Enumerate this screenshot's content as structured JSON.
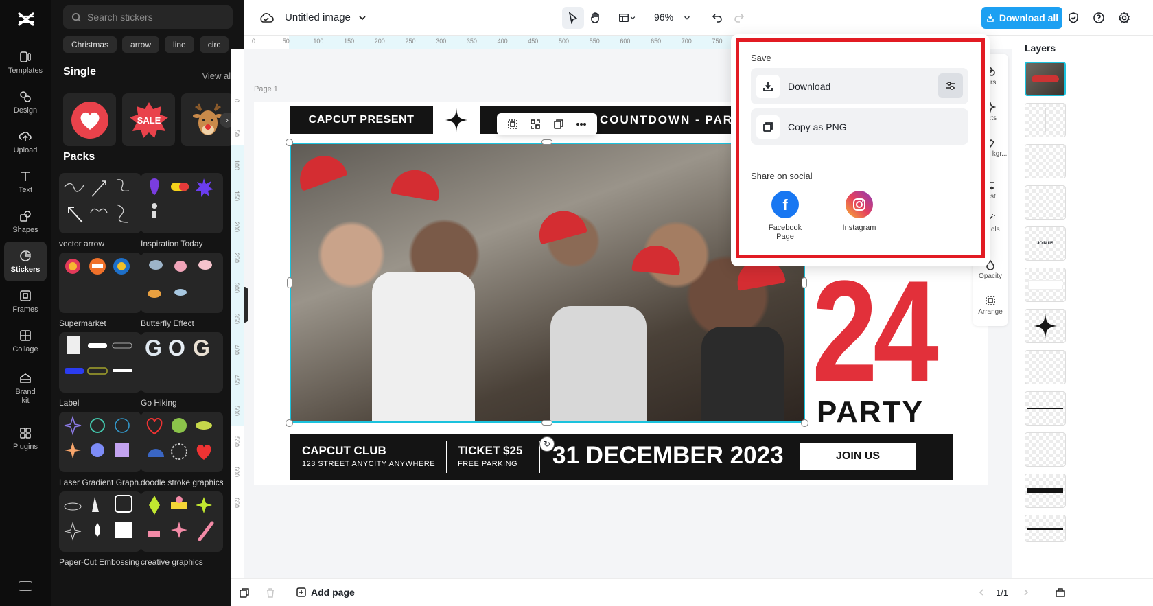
{
  "rail": {
    "items": [
      {
        "label": "Templates",
        "icon": "templates-icon"
      },
      {
        "label": "Design",
        "icon": "design-icon"
      },
      {
        "label": "Upload",
        "icon": "upload-icon"
      },
      {
        "label": "Text",
        "icon": "text-icon"
      },
      {
        "label": "Shapes",
        "icon": "shapes-icon"
      },
      {
        "label": "Stickers",
        "icon": "stickers-icon"
      },
      {
        "label": "Frames",
        "icon": "frames-icon"
      },
      {
        "label": "Collage",
        "icon": "collage-icon"
      },
      {
        "label": "Brand kit",
        "icon": "brand-kit-icon"
      },
      {
        "label": "Plugins",
        "icon": "plugins-icon"
      }
    ],
    "active": "Stickers"
  },
  "panel": {
    "search_placeholder": "Search stickers",
    "chips": [
      "Christmas",
      "arrow",
      "line",
      "circ"
    ],
    "single_title": "Single",
    "view_all": "View all",
    "single_stickers": [
      "heart",
      "SALE",
      "reindeer"
    ],
    "packs_title": "Packs",
    "packs": [
      {
        "label": "vector arrow"
      },
      {
        "label": "Inspiration Today"
      },
      {
        "label": "Supermarket"
      },
      {
        "label": "Butterfly Effect"
      },
      {
        "label": "Label"
      },
      {
        "label": "Go Hiking"
      },
      {
        "label": "Laser Gradient Graph..."
      },
      {
        "label": "doodle stroke graphics"
      },
      {
        "label": "Paper-Cut Embossing"
      },
      {
        "label": "creative graphics"
      }
    ]
  },
  "topbar": {
    "title": "Untitled image",
    "zoom": "96%",
    "download_all": "Download all"
  },
  "ruler": {
    "h_ticks": [
      "0",
      "50",
      "100",
      "150",
      "200",
      "250",
      "300",
      "350",
      "400",
      "450",
      "500",
      "550",
      "600",
      "650",
      "700",
      "750"
    ],
    "v_ticks": [
      "0",
      "50",
      "100",
      "150",
      "200",
      "250",
      "300",
      "350",
      "400",
      "450",
      "500",
      "550",
      "600",
      "650"
    ]
  },
  "canvas": {
    "page_label": "Page 1",
    "capcut_present": "CAPCUT PRESENT",
    "countdown": "COUNTDOWN - PART",
    "big_number": "24",
    "party": "PARTY",
    "club": "CAPCUT CLUB",
    "address": "123 STREET ANYCITY ANYWHERE",
    "ticket": "TICKET $25",
    "parking": "FREE PARKING",
    "date": "31 DECEMBER 2023",
    "join": "JOIN US"
  },
  "popover": {
    "save_label": "Save",
    "download_label": "Download",
    "copy_label": "Copy as PNG",
    "share_label": "Share on social",
    "facebook_label": "Facebook Page",
    "instagram_label": "Instagram"
  },
  "right_tools": [
    "ters",
    "ects",
    "move kgr...",
    "just",
    "art ols",
    "Opacity",
    "Arrange"
  ],
  "layers": {
    "title": "Layers",
    "thumb_text": "JOIN US"
  },
  "bottombar": {
    "add_page": "Add page",
    "page_count": "1/1"
  },
  "colors": {
    "accent": "#1ca0f2",
    "highlight": "#e21b23",
    "party_red": "#e2303a",
    "selection": "#1bc2dd"
  }
}
